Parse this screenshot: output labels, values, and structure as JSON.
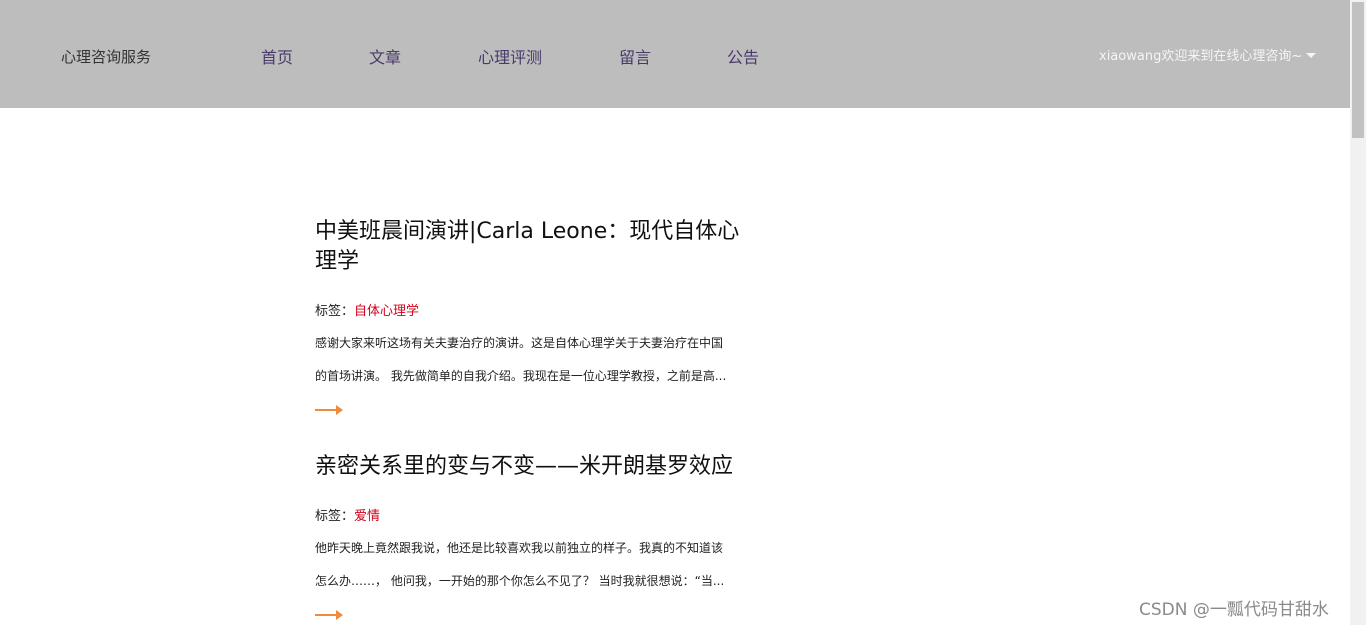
{
  "header": {
    "brand": "心理咨询服务",
    "nav": [
      "首页",
      "文章",
      "心理评测",
      "留言",
      "公告"
    ],
    "user_greeting": "xiaowang欢迎来到在线心理咨询~"
  },
  "articles": [
    {
      "title": "中美班晨间演讲|Carla Leone：现代自体心理学",
      "tag_label": "标签：",
      "tag": "自体心理学",
      "excerpt_line1": "感谢大家来听这场有关夫妻治疗的演讲。这是自体心理学关于夫妻治疗在中国",
      "excerpt_line2": "的首场讲演。 我先做简单的自我介绍。我现在是一位心理学教授，之前是高..."
    },
    {
      "title": "亲密关系里的变与不变——米开朗基罗效应",
      "tag_label": "标签：",
      "tag": "爱情",
      "excerpt_line1": "他昨天晚上竟然跟我说，他还是比较喜欢我以前独立的样子。我真的不知道该",
      "excerpt_line2": "怎么办……， 他问我，一开始的那个你怎么不见了？ 当时我就很想说：“当..."
    }
  ],
  "watermark": "CSDN @一瓢代码甘甜水",
  "icons": {
    "user_menu": "caret-down-icon",
    "read_more": "arrow-right-icon"
  },
  "colors": {
    "header_bg": "#bdbdbd",
    "tag": "#d0021b",
    "arrow": "#f08a3c"
  }
}
